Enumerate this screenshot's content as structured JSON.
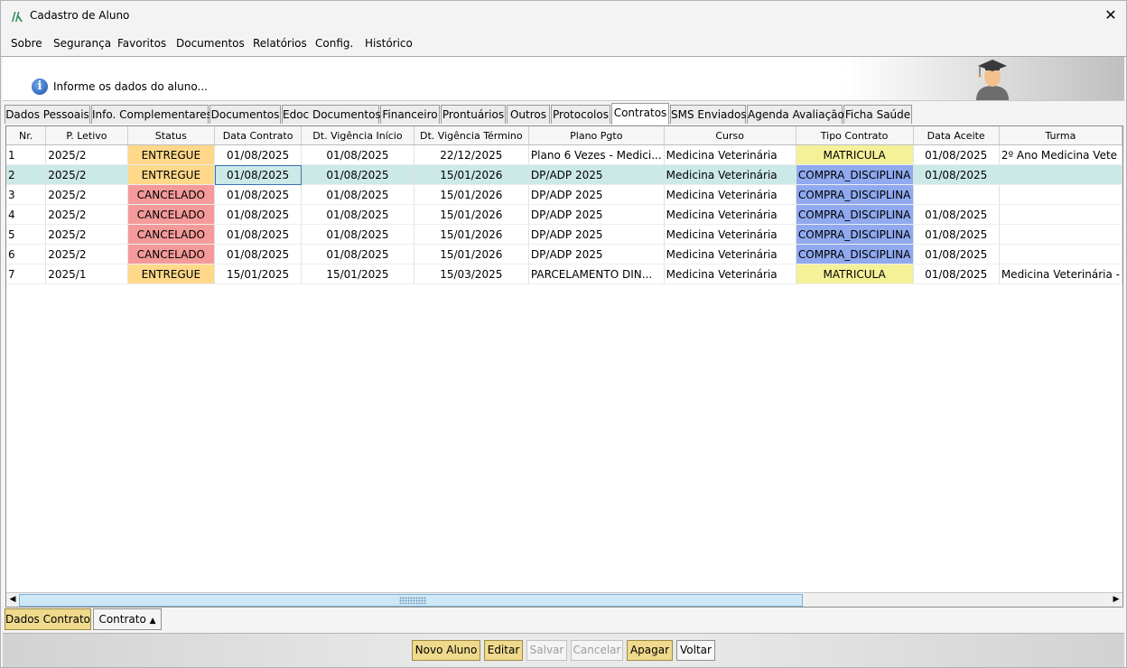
{
  "window": {
    "title": "Cadastro de Aluno",
    "close_glyph": "✕"
  },
  "menu": [
    "Sobre",
    "Segurança",
    "Favoritos",
    "Documentos",
    "Relatórios",
    "Config.",
    "Histórico"
  ],
  "banner": {
    "info_text": "Informe os dados do aluno..."
  },
  "tabs": [
    "Dados Pessoais",
    "Info. Complementares",
    "Documentos",
    "Edoc Documentos",
    "Financeiro",
    "Prontuários",
    "Outros",
    "Protocolos",
    "Contratos",
    "SMS Enviados",
    "Agenda Avaliação",
    "Ficha Saúde"
  ],
  "active_tab": "Contratos",
  "table": {
    "columns": [
      "Nr.",
      "P. Letivo",
      "Status",
      "Data Contrato",
      "Dt. Vigência Início",
      "Dt. Vigência Término",
      "Plano Pgto",
      "Curso",
      "Tipo Contrato",
      "Data Aceite",
      "Turma"
    ],
    "rows": [
      [
        "1",
        "2025/2",
        "ENTREGUE",
        "01/08/2025",
        "01/08/2025",
        "22/12/2025",
        "Plano 6 Vezes - Medici...",
        "Medicina Veterinária",
        "MATRICULA",
        "01/08/2025",
        "2º Ano Medicina Vete"
      ],
      [
        "2",
        "2025/2",
        "ENTREGUE",
        "01/08/2025",
        "01/08/2025",
        "15/01/2026",
        "DP/ADP 2025",
        "Medicina Veterinária",
        "COMPRA_DISCIPLINA",
        "01/08/2025",
        ""
      ],
      [
        "3",
        "2025/2",
        "CANCELADO",
        "01/08/2025",
        "01/08/2025",
        "15/01/2026",
        "DP/ADP 2025",
        "Medicina Veterinária",
        "COMPRA_DISCIPLINA",
        "",
        ""
      ],
      [
        "4",
        "2025/2",
        "CANCELADO",
        "01/08/2025",
        "01/08/2025",
        "15/01/2026",
        "DP/ADP 2025",
        "Medicina Veterinária",
        "COMPRA_DISCIPLINA",
        "01/08/2025",
        ""
      ],
      [
        "5",
        "2025/2",
        "CANCELADO",
        "01/08/2025",
        "01/08/2025",
        "15/01/2026",
        "DP/ADP 2025",
        "Medicina Veterinária",
        "COMPRA_DISCIPLINA",
        "01/08/2025",
        ""
      ],
      [
        "6",
        "2025/2",
        "CANCELADO",
        "01/08/2025",
        "01/08/2025",
        "15/01/2026",
        "DP/ADP 2025",
        "Medicina Veterinária",
        "COMPRA_DISCIPLINA",
        "01/08/2025",
        ""
      ],
      [
        "7",
        "2025/1",
        "ENTREGUE",
        "15/01/2025",
        "15/01/2025",
        "15/03/2025",
        "PARCELAMENTO DIN...",
        "Medicina Veterinária",
        "MATRICULA",
        "01/08/2025",
        "Medicina Veterinária -"
      ]
    ],
    "selected_row": 2
  },
  "status_colors": {
    "ENTREGUE": "#ffd88a",
    "CANCELADO": "#f59a9a",
    "MATRICULA": "#f4f199",
    "COMPRA_DISCIPLINA": "#90a9ef"
  },
  "subtabs": {
    "dados_contrato": "Dados Contrato",
    "contrato": "Contrato",
    "contrato_arrow": "▲"
  },
  "actions": {
    "novo_aluno": "Novo Aluno",
    "editar": "Editar",
    "salvar": "Salvar",
    "cancelar": "Cancelar",
    "apagar": "Apagar",
    "voltar": "Voltar"
  },
  "scrollbar": {
    "left_arrow": "◀",
    "right_arrow": "▶"
  }
}
